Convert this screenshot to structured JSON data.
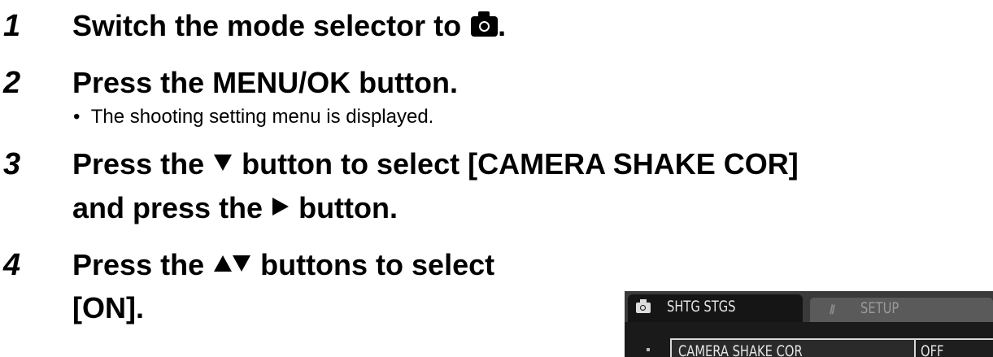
{
  "steps": [
    {
      "number": "1",
      "text_before": "Switch the mode selector to ",
      "icon": "camera-mode-icon",
      "text_after": "."
    },
    {
      "number": "2",
      "text": "Press the MENU/OK button.",
      "bullet": "The shooting setting menu is displayed."
    },
    {
      "number": "3",
      "line1_before": "Press the ",
      "line1_icon": "down-triangle-icon",
      "line1_after": " button to select [CAMERA SHAKE COR]",
      "line2_before": "and press the ",
      "line2_icon": "right-triangle-icon",
      "line2_after": " button."
    },
    {
      "number": "4",
      "line1_before": "Press the ",
      "line1_icon": "up-down-triangle-icons",
      "line1_after": " buttons to select",
      "line2": "[ON]."
    }
  ],
  "lcd": {
    "active_tab": "SHTG STGS",
    "inactive_tab": "SETUP",
    "row_label": "CAMERA SHAKE COR",
    "row_value": "OFF"
  }
}
